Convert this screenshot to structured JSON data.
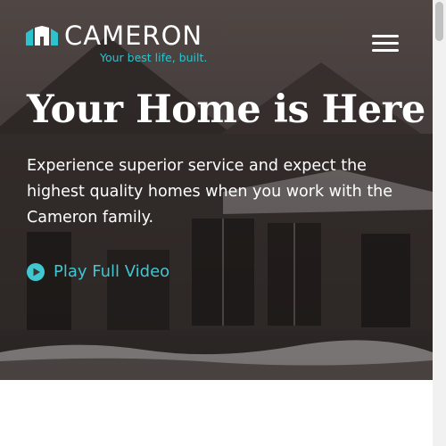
{
  "header": {
    "brand_name": "CAMERON",
    "tagline": "Your best life, built.",
    "menu_icon": "hamburger-menu-icon"
  },
  "hero": {
    "title": "Your Home is Here",
    "description": "Experience superior service and expect the highest quality homes when you work with the Cameron family.",
    "play_label": "Play Full Video",
    "play_icon": "play-circle-icon"
  },
  "colors": {
    "accent": "#3fc7d2",
    "logo_accent": "#2cc3cd",
    "text": "#ffffff"
  }
}
